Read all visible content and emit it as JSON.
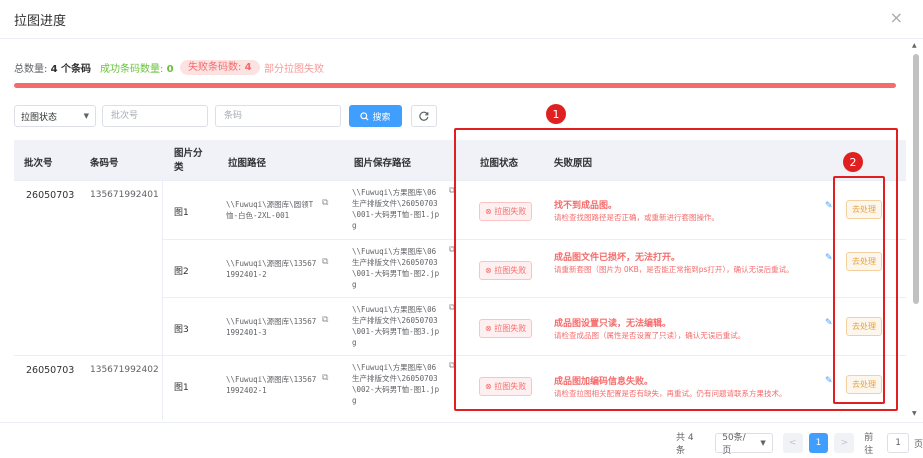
{
  "dialog": {
    "title": "拉图进度",
    "close_icon": "×"
  },
  "stats": {
    "total_label": "总数量:",
    "total_value": "4 个条码",
    "success_label": "成功条码数量:",
    "success_value": "0",
    "fail_label": "失败条码数:",
    "fail_value": "4",
    "partial_label": "部分拉图失败",
    "progress_percent": 100,
    "progress_color": "#f56c6c"
  },
  "filters": {
    "status_select": "拉图状态",
    "batch_placeholder": "批次号",
    "code_placeholder": "条码",
    "search_label": "搜索",
    "search_icon": "search-icon",
    "refresh_icon": "refresh-icon"
  },
  "table": {
    "headers": [
      "批次号",
      "条码号",
      "图片分类",
      "拉图路径",
      "图片保存路径",
      "拉图状态",
      "失败原因"
    ],
    "rows": [
      {
        "batch": "26050703",
        "code": "135671992401",
        "category": "图1",
        "pull_path": "\\\\Fuwuqi\\源图库\\圆领T\n恤-白色-2XL-001",
        "save_path": "\\\\Fuwuqi\\方果图库\\06\n生产排版文件\\26050703\n\\001-大码男T恤-图1.jp\ng",
        "status": "拉图失败",
        "reason_title": "找不到成品图。",
        "reason_desc": "请检查找图路径是否正确，或重新进行套图操作。",
        "action": "去处理"
      },
      {
        "batch": "",
        "code": "",
        "category": "图2",
        "pull_path": "\\\\Fuwuqi\\源图库\\13567\n1992401-2",
        "save_path": "\\\\Fuwuqi\\方果图库\\06\n生产排版文件\\26050703\n\\001-大码男T恤-图2.jp\ng",
        "status": "拉图失败",
        "reason_title": "成品图文件已损坏，无法打开。",
        "reason_desc": "请重新套图（图片为 0KB，是否能正常拖到ps打开），确认无误后重试。",
        "action": "去处理"
      },
      {
        "batch": "",
        "code": "",
        "category": "图3",
        "pull_path": "\\\\Fuwuqi\\源图库\\13567\n1992401-3",
        "save_path": "\\\\Fuwuqi\\方果图库\\06\n生产排版文件\\26050703\n\\001-大码男T恤-图3.jp\ng",
        "status": "拉图失败",
        "reason_title": "成品图设置只读，无法编辑。",
        "reason_desc": "请检查成品图（属性是否设置了只读），确认无误后重试。",
        "action": "去处理"
      },
      {
        "batch": "26050703",
        "code": "135671992402",
        "category": "图1",
        "pull_path": "\\\\Fuwuqi\\源图库\\13567\n1992402-1",
        "save_path": "\\\\Fuwuqi\\方果图库\\06\n生产排版文件\\26050703\n\\002-大码男T恤-图1.jp\ng",
        "status": "拉图失败",
        "reason_title": "成品图加编码信息失败。",
        "reason_desc": "请检查拉图相关配置是否有缺失，再重试。仍有问题请联系方果技术。",
        "action": "去处理"
      }
    ]
  },
  "annotations": {
    "box1": "1",
    "box2": "2",
    "color": "#e02020"
  },
  "pagination": {
    "total": "共 4 条",
    "page_size": "50条/页",
    "prev": "<",
    "current": "1",
    "next": ">",
    "goto_label": "前往",
    "goto_value": "1",
    "page_unit": "页"
  }
}
